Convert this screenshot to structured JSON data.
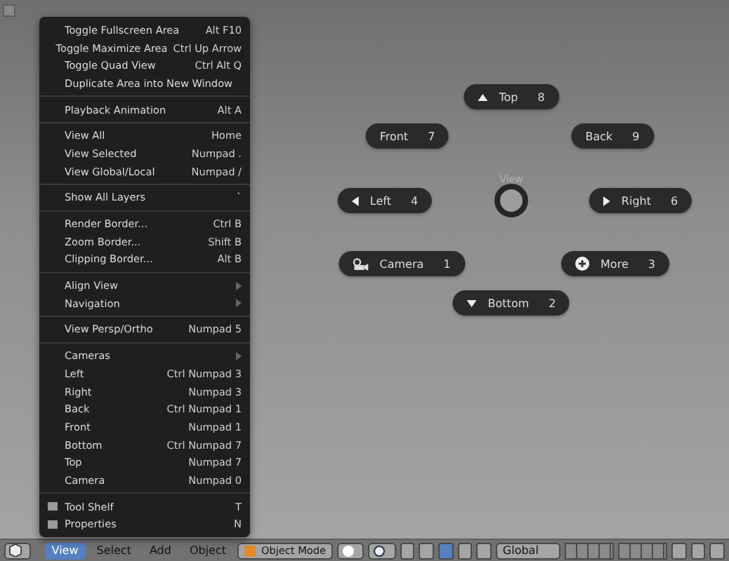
{
  "menu": {
    "sections": [
      [
        {
          "label": "Toggle Fullscreen Area",
          "shortcut": "Alt F10",
          "kind": "item"
        },
        {
          "label": "Toggle Maximize Area",
          "shortcut": "Ctrl Up Arrow",
          "kind": "item"
        },
        {
          "label": "Toggle Quad View",
          "shortcut": "Ctrl Alt Q",
          "kind": "item"
        },
        {
          "label": "Duplicate Area into New Window",
          "kind": "item"
        }
      ],
      [
        {
          "label": "Playback Animation",
          "shortcut": "Alt A",
          "kind": "item"
        }
      ],
      [
        {
          "label": "View All",
          "shortcut": "Home",
          "kind": "item"
        },
        {
          "label": "View Selected",
          "shortcut": "Numpad .",
          "kind": "item"
        },
        {
          "label": "View Global/Local",
          "shortcut": "Numpad /",
          "kind": "item"
        }
      ],
      [
        {
          "label": "Show All Layers",
          "shortcut": "`",
          "kind": "item"
        }
      ],
      [
        {
          "label": "Render Border...",
          "shortcut": "Ctrl B",
          "kind": "item"
        },
        {
          "label": "Zoom Border...",
          "shortcut": "Shift B",
          "kind": "item"
        },
        {
          "label": "Clipping Border...",
          "shortcut": "Alt B",
          "kind": "item"
        }
      ],
      [
        {
          "label": "Align View",
          "kind": "submenu"
        },
        {
          "label": "Navigation",
          "kind": "submenu"
        }
      ],
      [
        {
          "label": "View Persp/Ortho",
          "shortcut": "Numpad 5",
          "kind": "item"
        }
      ],
      [
        {
          "label": "Cameras",
          "kind": "submenu"
        },
        {
          "label": "Left",
          "shortcut": "Ctrl Numpad 3",
          "kind": "item"
        },
        {
          "label": "Right",
          "shortcut": "Numpad 3",
          "kind": "item"
        },
        {
          "label": "Back",
          "shortcut": "Ctrl Numpad 1",
          "kind": "item"
        },
        {
          "label": "Front",
          "shortcut": "Numpad 1",
          "kind": "item"
        },
        {
          "label": "Bottom",
          "shortcut": "Ctrl Numpad 7",
          "kind": "item"
        },
        {
          "label": "Top",
          "shortcut": "Numpad 7",
          "kind": "item"
        },
        {
          "label": "Camera",
          "shortcut": "Numpad 0",
          "kind": "item"
        }
      ],
      [
        {
          "label": "Tool Shelf",
          "shortcut": "T",
          "kind": "checkbox",
          "checked": false
        },
        {
          "label": "Properties",
          "shortcut": "N",
          "kind": "checkbox",
          "checked": false
        }
      ]
    ]
  },
  "pie": {
    "title": "View",
    "items": [
      {
        "label": "Top",
        "key": "8"
      },
      {
        "label": "Front",
        "key": "7"
      },
      {
        "label": "Back",
        "key": "9"
      },
      {
        "label": "Left",
        "key": "4"
      },
      {
        "label": "Right",
        "key": "6"
      },
      {
        "label": "Camera",
        "key": "1"
      },
      {
        "label": "More",
        "key": "3"
      },
      {
        "label": "Bottom",
        "key": "2"
      }
    ]
  },
  "header": {
    "menus": [
      {
        "label": "View",
        "selected": true
      },
      {
        "label": "Select",
        "selected": false
      },
      {
        "label": "Add",
        "selected": false
      },
      {
        "label": "Object",
        "selected": false
      }
    ],
    "mode": "Object Mode",
    "orientation": "Global"
  }
}
